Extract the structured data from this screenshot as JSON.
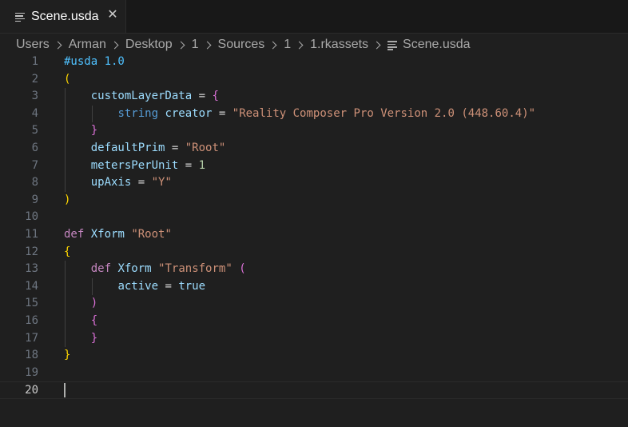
{
  "tab": {
    "icon": "file-lines-icon",
    "label": "Scene.usda",
    "close_glyph": "✕"
  },
  "breadcrumb": [
    "Users",
    "Arman",
    "Desktop",
    "1",
    "Sources",
    "1",
    "1.rkassets"
  ],
  "breadcrumb_file": "Scene.usda",
  "editor": {
    "current_line": 20,
    "lines": [
      {
        "n": "1",
        "tokens": [
          [
            "#usda 1.0",
            "t-comment"
          ]
        ]
      },
      {
        "n": "2",
        "tokens": [
          [
            "(",
            "t-b1"
          ]
        ]
      },
      {
        "n": "3",
        "tokens": [
          [
            "    ",
            "t-plain"
          ],
          [
            "customLayerData",
            "t-var"
          ],
          [
            " = ",
            "t-punct"
          ],
          [
            "{",
            "t-b2"
          ]
        ]
      },
      {
        "n": "4",
        "tokens": [
          [
            "        ",
            "t-plain"
          ],
          [
            "string",
            "t-ctl"
          ],
          [
            " ",
            "t-plain"
          ],
          [
            "creator",
            "t-var"
          ],
          [
            " = ",
            "t-punct"
          ],
          [
            "\"Reality Composer Pro Version 2.0 (448.60.4)\"",
            "t-str"
          ]
        ]
      },
      {
        "n": "5",
        "tokens": [
          [
            "    ",
            "t-plain"
          ],
          [
            "}",
            "t-b2"
          ]
        ]
      },
      {
        "n": "6",
        "tokens": [
          [
            "    ",
            "t-plain"
          ],
          [
            "defaultPrim",
            "t-var"
          ],
          [
            " = ",
            "t-punct"
          ],
          [
            "\"Root\"",
            "t-str"
          ]
        ]
      },
      {
        "n": "7",
        "tokens": [
          [
            "    ",
            "t-plain"
          ],
          [
            "metersPerUnit",
            "t-var"
          ],
          [
            " = ",
            "t-punct"
          ],
          [
            "1",
            "t-num"
          ]
        ]
      },
      {
        "n": "8",
        "tokens": [
          [
            "    ",
            "t-plain"
          ],
          [
            "upAxis",
            "t-var"
          ],
          [
            " = ",
            "t-punct"
          ],
          [
            "\"Y\"",
            "t-str"
          ]
        ]
      },
      {
        "n": "9",
        "tokens": [
          [
            ")",
            "t-b1"
          ]
        ]
      },
      {
        "n": "10",
        "tokens": []
      },
      {
        "n": "11",
        "tokens": [
          [
            "def",
            "t-kw"
          ],
          [
            " ",
            "t-plain"
          ],
          [
            "Xform",
            "t-var"
          ],
          [
            " ",
            "t-plain"
          ],
          [
            "\"Root\"",
            "t-str"
          ]
        ]
      },
      {
        "n": "12",
        "tokens": [
          [
            "{",
            "t-b1"
          ]
        ]
      },
      {
        "n": "13",
        "tokens": [
          [
            "    ",
            "t-plain"
          ],
          [
            "def",
            "t-kw"
          ],
          [
            " ",
            "t-plain"
          ],
          [
            "Xform",
            "t-var"
          ],
          [
            " ",
            "t-plain"
          ],
          [
            "\"Transform\"",
            "t-str"
          ],
          [
            " ",
            "t-plain"
          ],
          [
            "(",
            "t-b2"
          ]
        ]
      },
      {
        "n": "14",
        "tokens": [
          [
            "        ",
            "t-plain"
          ],
          [
            "active",
            "t-var"
          ],
          [
            " = ",
            "t-punct"
          ],
          [
            "true",
            "t-var"
          ]
        ]
      },
      {
        "n": "15",
        "tokens": [
          [
            "    ",
            "t-plain"
          ],
          [
            ")",
            "t-b2"
          ]
        ]
      },
      {
        "n": "16",
        "tokens": [
          [
            "    ",
            "t-plain"
          ],
          [
            "{",
            "t-b2"
          ]
        ]
      },
      {
        "n": "17",
        "tokens": [
          [
            "    ",
            "t-plain"
          ],
          [
            "}",
            "t-b2"
          ]
        ]
      },
      {
        "n": "18",
        "tokens": [
          [
            "}",
            "t-b1"
          ]
        ]
      },
      {
        "n": "19",
        "tokens": []
      },
      {
        "n": "20",
        "tokens": []
      }
    ]
  }
}
